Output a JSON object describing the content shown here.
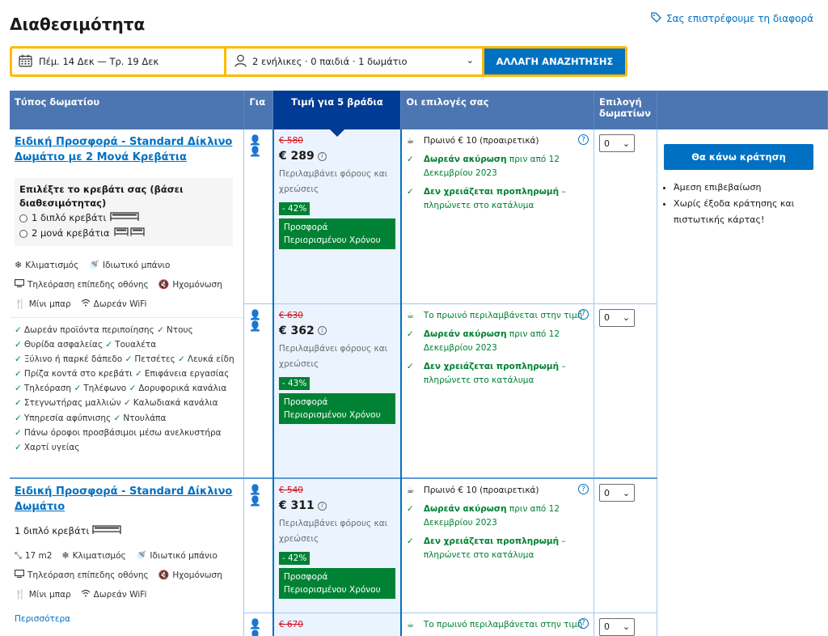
{
  "page": {
    "title": "Διαθεσιμότητα",
    "refund_link": "Σας επιστρέφουμε τη διαφορά"
  },
  "search": {
    "dates": "Πέμ. 14 Δεκ — Τρ. 19 Δεκ",
    "guests": "2 ενήλικες · 0 παιδιά · 1 δωμάτιο",
    "button": "ΑΛΛΑΓΗ ΑΝΑΖΗΤΗΣΗΣ"
  },
  "table": {
    "headers": {
      "type": "Τύπος δωματίου",
      "for": "Για",
      "price": "Τιμή για 5 βράδια",
      "options": "Οι επιλογές σας",
      "select": "Επιλογή δωματίων"
    }
  },
  "room1": {
    "name": "Ειδική Προσφορά - Standard Δίκλινο Δωμάτιο με 2 Μονά Κρεβάτια",
    "bed_title": "Επιλέξτε το κρεβάτι σας (βάσει διαθεσιμότητας)",
    "bed_opt1": "1 διπλό κρεβάτι",
    "bed_opt2": "2 μονά κρεβάτια",
    "fac": [
      "Κλιματισμός",
      "Ιδιωτικό μπάνιο",
      "Τηλεόραση επίπεδης οθόνης",
      "Ηχομόνωση",
      "Μίνι μπαρ",
      "Δωρεάν WiFi"
    ],
    "amenities": [
      [
        "Δωρεάν προϊόντα περιποίησης",
        "Ντους"
      ],
      [
        "Θυρίδα ασφαλείας",
        "Τουαλέτα"
      ],
      [
        "Ξύλινο ή παρκέ δάπεδο",
        "Πετσέτες",
        "Λευκά είδη"
      ],
      [
        "Πρίζα κοντά στο κρεβάτι",
        "Επιφάνεια εργασίας"
      ],
      [
        "Τηλεόραση",
        "Τηλέφωνο",
        "Δορυφορικά κανάλια"
      ],
      [
        "Στεγνωτήρας μαλλιών",
        "Καλωδιακά κανάλια"
      ],
      [
        "Υπηρεσία αφύπνισης",
        "Ντουλάπα"
      ],
      [
        "Πάνω όροφοι προσβάσιμοι μέσω ανελκυστήρα"
      ],
      [
        "Χαρτί υγείας"
      ]
    ]
  },
  "room2": {
    "name": "Ειδική Προσφορά - Standard Δίκλινο Δωμάτιο",
    "bed": "1 διπλό κρεβάτι",
    "fac": [
      "17 m2",
      "Κλιματισμός",
      "Ιδιωτικό μπάνιο",
      "Τηλεόραση επίπεδης οθόνης",
      "Ηχομόνωση",
      "Μίνι μπαρ",
      "Δωρεάν WiFi"
    ],
    "more": "Περισσότερα"
  },
  "offers": [
    {
      "old": "€ 580",
      "new": "€ 289",
      "taxes": "Περιλαμβάνει φόρους και χρεώσεις",
      "disc": "- 42%",
      "deal": "Προσφορά Περιορισμένου Χρόνου",
      "breakfast": "Πρωινό € 10 (προαιρετικά)",
      "breakfast_included": false
    },
    {
      "old": "€ 630",
      "new": "€ 362",
      "taxes": "Περιλαμβάνει φόρους και χρεώσεις",
      "disc": "- 43%",
      "deal": "Προσφορά Περιορισμένου Χρόνου",
      "breakfast": "Το πρωινό περιλαμβάνεται στην τιμή",
      "breakfast_included": true
    },
    {
      "old": "€ 540",
      "new": "€ 311",
      "taxes": "Περιλαμβάνει φόρους και χρεώσεις",
      "disc": "- 42%",
      "deal": "Προσφορά Περιορισμένου Χρόνου",
      "breakfast": "Πρωινό € 10 (προαιρετικά)",
      "breakfast_included": false
    },
    {
      "old": "€ 670",
      "new": "",
      "taxes": "",
      "disc": "",
      "deal": "",
      "breakfast": "Το πρωινό περιλαμβάνεται στην τιμή",
      "breakfast_included": true
    }
  ],
  "options_common": {
    "free_cancel_bold": "Δωρεάν ακύρωση",
    "free_cancel_rest": "πριν από 12 Δεκεμβρίου 2023",
    "no_prepay_bold": "Δεν χρειάζεται προπληρωμή",
    "no_prepay_rest": "– πληρώνετε στο κατάλυμα",
    "select_value": "0"
  },
  "booking": {
    "button": "Θα κάνω κράτηση",
    "bullets": [
      "Άμεση επιβεβαίωση",
      "Χωρίς έξοδα κράτησης και πιστωτικής κάρτας!"
    ]
  },
  "colors": {
    "header_blue": "#4c76b2",
    "price_header": "#003b95",
    "brand_blue": "#0071c2",
    "green": "#008234",
    "red": "#d4111e",
    "yellow": "#febb02"
  }
}
